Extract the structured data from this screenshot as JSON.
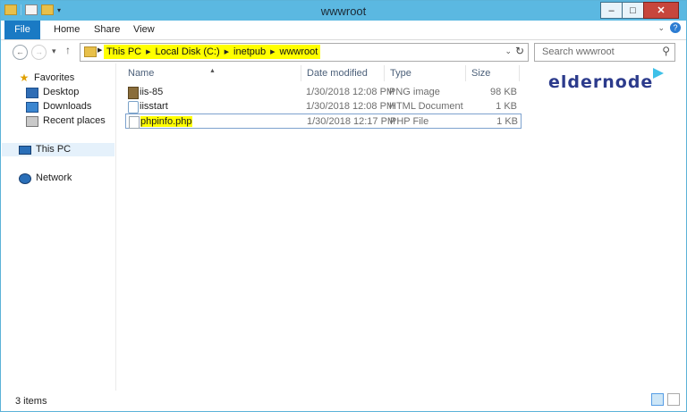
{
  "window": {
    "title": "wwwroot"
  },
  "ribbon": {
    "tabs": [
      "File",
      "Home",
      "Share",
      "View"
    ]
  },
  "address": {
    "crumbs": [
      "This PC",
      "Local Disk (C:)",
      "inetpub",
      "wwwroot"
    ]
  },
  "search": {
    "placeholder": "Search wwwroot"
  },
  "nav": {
    "favorites": "Favorites",
    "desktop": "Desktop",
    "downloads": "Downloads",
    "recent": "Recent places",
    "this_pc": "This PC",
    "network": "Network"
  },
  "columns": {
    "name": "Name",
    "date": "Date modified",
    "type": "Type",
    "size": "Size"
  },
  "files": [
    {
      "name": "iis-85",
      "date": "1/30/2018 12:08 PM",
      "type": "PNG image",
      "size": "98 KB",
      "icon": "png-file-icon"
    },
    {
      "name": "iisstart",
      "date": "1/30/2018 12:08 PM",
      "type": "HTML Document",
      "size": "1 KB",
      "icon": "html-file-icon"
    },
    {
      "name": "phpinfo.php",
      "date": "1/30/2018 12:17 PM",
      "type": "PHP File",
      "size": "1 KB",
      "icon": "php-file-icon"
    }
  ],
  "status": {
    "count": "3 items"
  },
  "logo": {
    "text": "eldernode"
  },
  "colors": {
    "titlebar": "#5bb8e1",
    "file_tab": "#1a7ac4",
    "highlight": "#ffff00",
    "close": "#c7463c"
  }
}
